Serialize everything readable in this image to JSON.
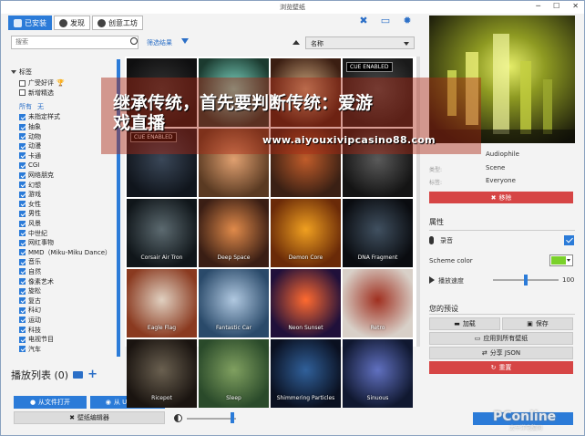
{
  "window": {
    "title": "浏览壁纸",
    "controls": [
      "─",
      "☐",
      "✕"
    ]
  },
  "tabs": [
    {
      "label": "已安装",
      "icon": "image-icon",
      "active": true
    },
    {
      "label": "发现",
      "icon": "compass-icon",
      "active": false
    },
    {
      "label": "创意工坊",
      "icon": "steam-icon",
      "active": false
    }
  ],
  "top_icons": [
    "tools-icon",
    "monitor-icon",
    "gear-icon"
  ],
  "search": {
    "placeholder": "搜索"
  },
  "filter_link": "筛选结果",
  "sort": {
    "selected": "名称"
  },
  "filters": {
    "tags_title": "标签",
    "approval": [
      {
        "label": "广受好评",
        "checked": false,
        "badge": "trophy-icon"
      },
      {
        "label": "新增精选",
        "checked": false
      }
    ],
    "all_label": "所有",
    "none_label": "无",
    "tags": [
      {
        "label": "未指定样式",
        "checked": true
      },
      {
        "label": "抽象",
        "checked": true
      },
      {
        "label": "动物",
        "checked": true
      },
      {
        "label": "动漫",
        "checked": true
      },
      {
        "label": "卡通",
        "checked": true
      },
      {
        "label": "CGI",
        "checked": true
      },
      {
        "label": "网络朋克",
        "checked": true
      },
      {
        "label": "幻想",
        "checked": true
      },
      {
        "label": "游戏",
        "checked": true
      },
      {
        "label": "女性",
        "checked": true
      },
      {
        "label": "男性",
        "checked": true
      },
      {
        "label": "风景",
        "checked": true
      },
      {
        "label": "中世纪",
        "checked": true
      },
      {
        "label": "网红事物",
        "checked": true
      },
      {
        "label": "MMD（Miku-Miku Dance）",
        "checked": true
      },
      {
        "label": "音乐",
        "checked": true
      },
      {
        "label": "自然",
        "checked": true
      },
      {
        "label": "像素艺术",
        "checked": true
      },
      {
        "label": "旋松",
        "checked": true
      },
      {
        "label": "复古",
        "checked": true
      },
      {
        "label": "科幻",
        "checked": true
      },
      {
        "label": "运动",
        "checked": true
      },
      {
        "label": "科技",
        "checked": true
      },
      {
        "label": "电视节目",
        "checked": true
      },
      {
        "label": "汽车",
        "checked": true
      }
    ]
  },
  "playlist": {
    "label": "播放列表 (0)"
  },
  "buttons": {
    "open_file": "从文件打开",
    "open_url": "从 URL 打开",
    "wallpaper_editor": "壁纸编辑器"
  },
  "wallpapers": [
    {
      "name": "",
      "cue": false
    },
    {
      "name": "",
      "cue": false
    },
    {
      "name": "",
      "cue": false
    },
    {
      "name": "",
      "cue": true
    },
    {
      "name": "",
      "cue": true
    },
    {
      "name": "",
      "cue": false
    },
    {
      "name": "",
      "cue": false
    },
    {
      "name": "",
      "cue": false
    },
    {
      "name": "Corsair Air Tron",
      "cue": false
    },
    {
      "name": "Deep Space",
      "cue": false
    },
    {
      "name": "Demon Core",
      "cue": false
    },
    {
      "name": "DNA Fragment",
      "cue": false
    },
    {
      "name": "Eagle Flag",
      "cue": false
    },
    {
      "name": "Fantastic Car",
      "cue": false
    },
    {
      "name": "Neon Sunset",
      "cue": false
    },
    {
      "name": "Retro",
      "cue": false
    },
    {
      "name": "Ricepot",
      "cue": false
    },
    {
      "name": "Sleep",
      "cue": false
    },
    {
      "name": "Shimmering Particles",
      "cue": false
    },
    {
      "name": "Sinuous",
      "cue": false
    }
  ],
  "cue_badge": "CUE ENABLED",
  "overlay": {
    "line1": "继承传统，首先要判断传统：爱游",
    "line2": "戏直播",
    "url": "www.aiyouxivipcasino88.com"
  },
  "details": {
    "author": "Audiophile",
    "type_label": "类型:",
    "type_value": "Scene",
    "rating_label": "标签:",
    "rating_value": "Everyone",
    "remove_button": "移除"
  },
  "properties": {
    "title": "属性",
    "audio_label": "录音",
    "audio_enabled": true,
    "scheme_color_label": "Scheme color",
    "scheme_color": "#7ad12a",
    "speed_label": "播放速度",
    "speed_value": "100",
    "speed_level": 0.5
  },
  "presets": {
    "title": "您的预设",
    "load": "加载",
    "save": "保存",
    "apply_all": "应用到所有壁纸",
    "share_json": "分享 JSON",
    "reset": "重置"
  },
  "watermark": {
    "brand": "PConline",
    "sub": "太平洋电脑网"
  },
  "volume_level": 0.92,
  "colors": {
    "accent": "#2b7bd8",
    "danger": "#d64545"
  }
}
